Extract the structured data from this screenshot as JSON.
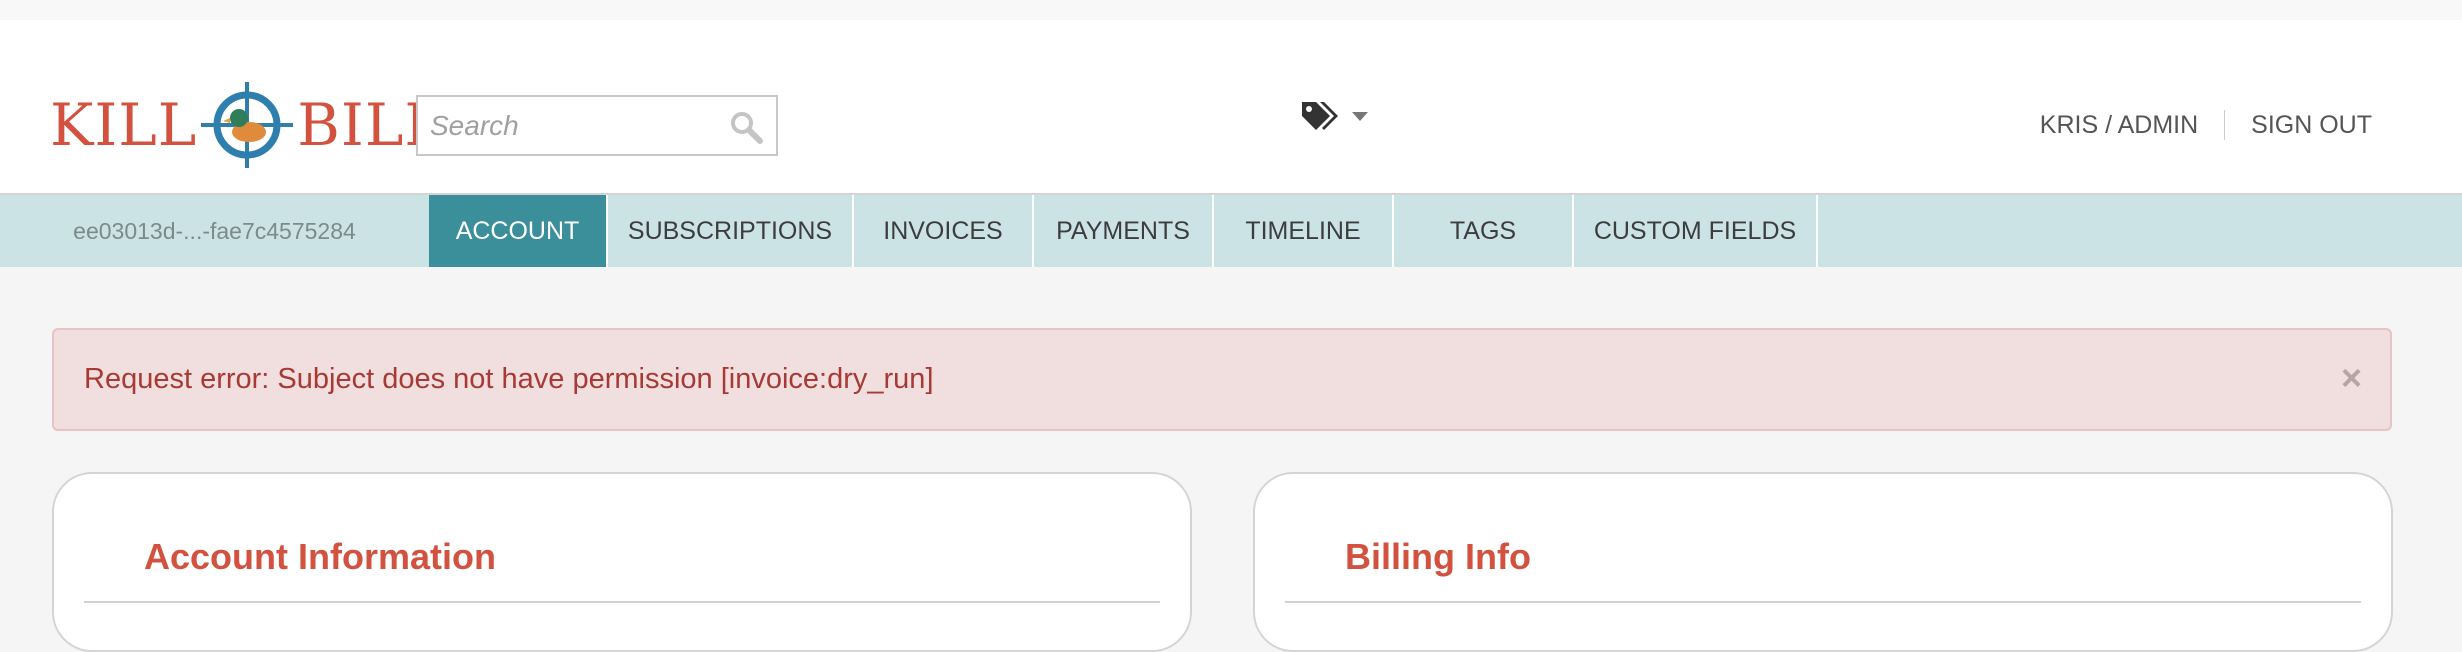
{
  "header": {
    "logo_left": "KILL",
    "logo_right": "BILL",
    "search": {
      "placeholder": "Search"
    },
    "user_label": "KRIS / ADMIN",
    "sign_out_label": "SIGN OUT"
  },
  "tabbar": {
    "account_id": "ee03013d-...-fae7c4575284",
    "tabs": [
      {
        "label": "ACCOUNT",
        "active": true
      },
      {
        "label": "SUBSCRIPTIONS",
        "active": false
      },
      {
        "label": "INVOICES",
        "active": false
      },
      {
        "label": "PAYMENTS",
        "active": false
      },
      {
        "label": "TIMELINE",
        "active": false
      },
      {
        "label": "TAGS",
        "active": false
      },
      {
        "label": "CUSTOM FIELDS",
        "active": false
      }
    ]
  },
  "alert": {
    "message": "Request error: Subject does not have permission [invoice:dry_run]",
    "close_glyph": "×"
  },
  "panels": {
    "account_title": "Account Information",
    "billing_title": "Billing Info"
  },
  "icons": {
    "search": "search-icon",
    "tags": "tags-icon",
    "dropdown": "caret-down-icon",
    "close": "close-icon"
  },
  "colors": {
    "brand_red": "#d2523f",
    "tab_active": "#3a8f9b",
    "tabbar_bg": "#cce3e6",
    "alert_bg": "#f1dede",
    "alert_text": "#a83a35"
  }
}
